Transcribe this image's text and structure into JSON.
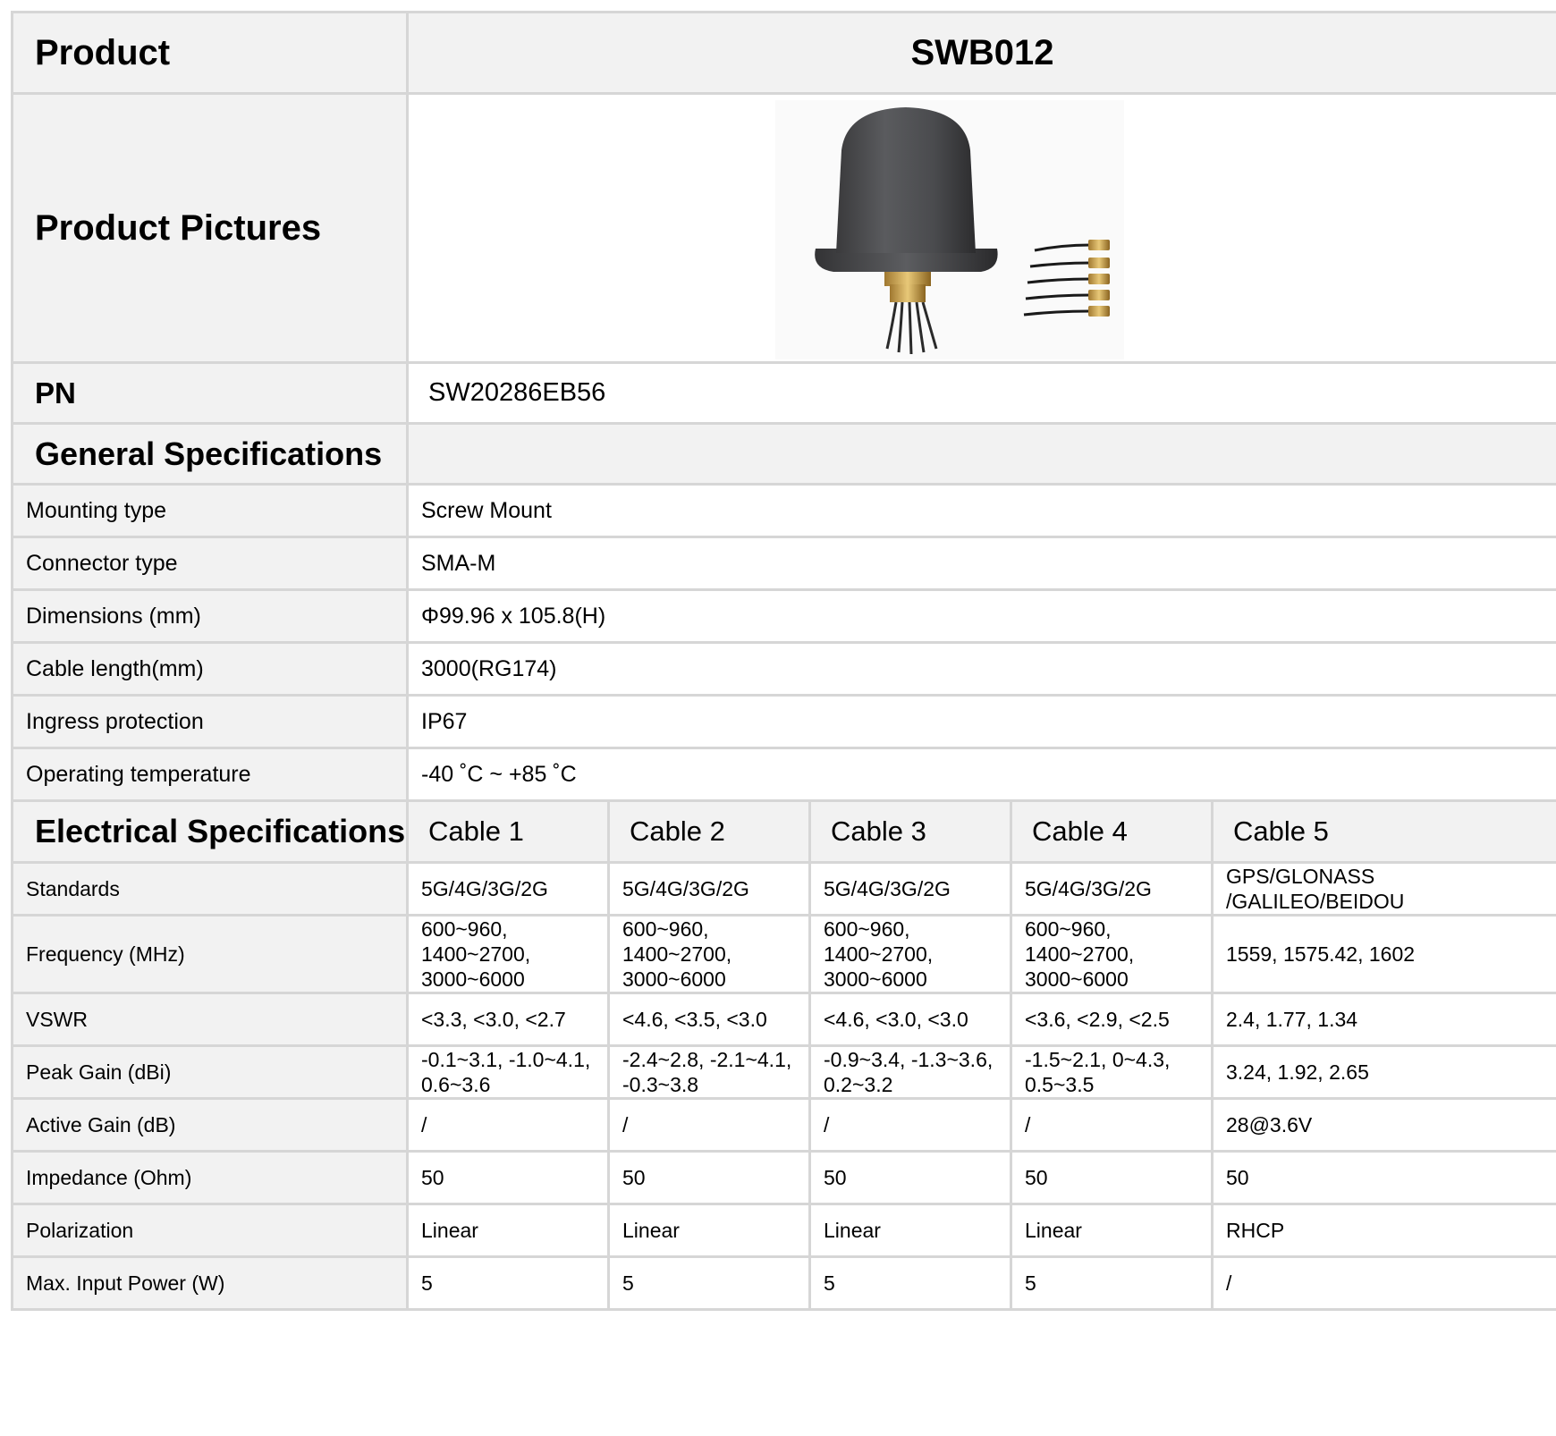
{
  "header": {
    "label": "Product",
    "model": "SWB012"
  },
  "pictures": {
    "label": "Product Pictures"
  },
  "pn": {
    "label": "PN",
    "value": "SW20286EB56"
  },
  "general": {
    "title": "General Specifications",
    "rows": [
      {
        "label": "Mounting type",
        "value": "Screw Mount"
      },
      {
        "label": "Connector type",
        "value": "SMA-M"
      },
      {
        "label": "Dimensions (mm)",
        "value": "Φ99.96 x 105.8(H)"
      },
      {
        "label": "Cable length(mm)",
        "value": "3000(RG174)"
      },
      {
        "label": "Ingress protection",
        "value": "IP67"
      },
      {
        "label": "Operating temperature",
        "value": "-40 ˚C ~ +85 ˚C"
      }
    ]
  },
  "electrical": {
    "title": "Electrical Specifications",
    "columns": [
      "Cable 1",
      "Cable 2",
      "Cable 3",
      "Cable 4",
      "Cable 5"
    ],
    "rows": [
      {
        "label": "Standards",
        "values": [
          "5G/4G/3G/2G",
          "5G/4G/3G/2G",
          "5G/4G/3G/2G",
          "5G/4G/3G/2G",
          "GPS/GLONASS /GALILEO/BEIDOU"
        ]
      },
      {
        "label": "Frequency (MHz)",
        "values": [
          "600~960, 1400~2700, 3000~6000",
          "600~960, 1400~2700, 3000~6000",
          "600~960, 1400~2700, 3000~6000",
          "600~960, 1400~2700, 3000~6000",
          "1559,    1575.42, 1602"
        ]
      },
      {
        "label": "VSWR",
        "values": [
          "<3.3,  <3.0,  <2.7",
          "<4.6,  <3.5,  <3.0",
          "<4.6,  <3.0,  <3.0",
          "<3.6,  <2.9,  <2.5",
          "2.4,  1.77,  1.34"
        ]
      },
      {
        "label": "Peak Gain (dBi)",
        "values": [
          "-0.1~3.1,   -1.0~4.1, 0.6~3.6",
          "-2.4~2.8,  -2.1~4.1, -0.3~3.8",
          "-0.9~3.4,  -1.3~3.6, 0.2~3.2",
          "-1.5~2.1,  0~4.3, 0.5~3.5",
          "3.24,  1.92,   2.65"
        ]
      },
      {
        "label": "Active Gain (dB)",
        "values": [
          "/",
          "/",
          "/",
          "/",
          "28@3.6V"
        ]
      },
      {
        "label": "Impedance (Ohm)",
        "values": [
          "50",
          "50",
          "50",
          "50",
          "50"
        ]
      },
      {
        "label": "Polarization",
        "values": [
          "Linear",
          "Linear",
          "Linear",
          "Linear",
          "RHCP"
        ]
      },
      {
        "label": "Max. Input Power (W)",
        "values": [
          "5",
          "5",
          "5",
          "5",
          "/"
        ]
      }
    ]
  }
}
